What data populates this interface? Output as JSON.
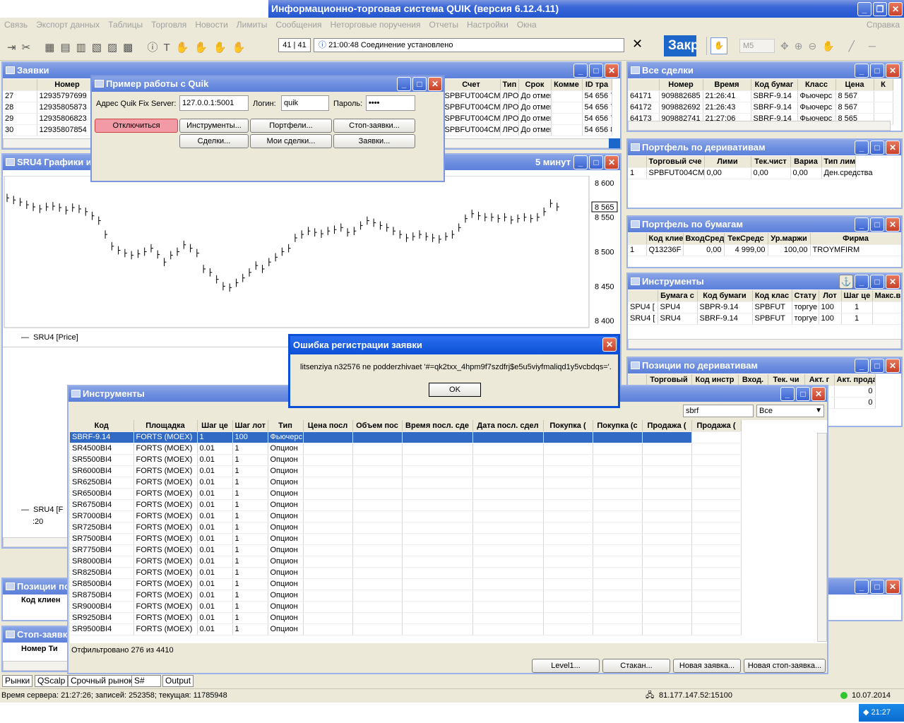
{
  "app": {
    "title": "Информационно-торговая система QUIK (версия 6.12.4.11)"
  },
  "menu": [
    "Связь",
    "Экспорт данных",
    "Таблицы",
    "Торговля",
    "Новости",
    "Лимиты",
    "Сообщения",
    "Неторговые поручения",
    "Отчеты",
    "Настройки",
    "Окна"
  ],
  "menu_help": "Справка",
  "toolbar": {
    "counter": "41 | 41",
    "status": "21:00:48  Соединение установлено",
    "close_btn": "Закр",
    "interval": "M5"
  },
  "zayavki": {
    "title": "Заявки",
    "cols": [
      "Номер",
      "Счет",
      "Тип",
      "Срок",
      "Комме",
      "ID тра"
    ],
    "rows": [
      [
        "27",
        "12935797699",
        "SPBFUT004CM",
        "ЛРО",
        "До отмен",
        "",
        "54 656 7"
      ],
      [
        "28",
        "12935805873",
        "SPBFUT004CM",
        "ЛРО",
        "До отмен",
        "",
        "54 656 7"
      ],
      [
        "29",
        "12935806823",
        "SPBFUT004CM",
        "ЛРО",
        "До отмен",
        "",
        "54 656 7"
      ],
      [
        "30",
        "12935807854",
        "SPBFUT004CM",
        "ЛРО",
        "До отмен",
        "",
        "54 656 8"
      ]
    ]
  },
  "primer": {
    "title": "Пример работы с Quik",
    "addr_label": "Адрес Quik Fix Server:",
    "addr_value": "127.0.0.1:5001",
    "login_label": "Логин:",
    "login_value": "quik",
    "pass_label": "Пароль:",
    "pass_value": "••••",
    "btn_disconnect": "Отключиться",
    "btn_instr": "Инструменты...",
    "btn_portf": "Портфели...",
    "btn_stop": "Стоп-заявки...",
    "btn_deals": "Сделки...",
    "btn_mydeals": "Мои сделки...",
    "btn_orders": "Заявки..."
  },
  "chart": {
    "title": "SRU4 Графики и",
    "interval": "5 минут",
    "legend": "SRU4 [Price]",
    "legend2": "SRU4 [F",
    "time_tick": ":20",
    "last": "8 565",
    "yticks": [
      "8 600",
      "8 550",
      "8 500",
      "8 450",
      "8 400"
    ]
  },
  "chart_data": {
    "type": "bar",
    "title": "SRU4 Графики и",
    "ylim": [
      8390,
      8610
    ],
    "series": [
      {
        "name": "SRU4 [Price]",
        "values": [
          8578,
          8575,
          8572,
          8568,
          8565,
          8562,
          8565,
          8566,
          8564,
          8560,
          8564,
          8562,
          8558,
          8552,
          8545,
          8525,
          8508,
          8502,
          8498,
          8495,
          8497,
          8500,
          8505,
          8496,
          8485,
          8495,
          8500,
          8510,
          8505,
          8498,
          8475,
          8470,
          8460,
          8450,
          8448,
          8455,
          8462,
          8470,
          8480,
          8475,
          8485,
          8492,
          8500,
          8505,
          8520,
          8525,
          8530,
          8528,
          8526,
          8530,
          8532,
          8535,
          8528,
          8530,
          8538,
          8545,
          8542,
          8538,
          8535,
          8530,
          8525,
          8520,
          8522,
          8525,
          8522,
          8520,
          8518,
          8522,
          8525,
          8535,
          8548,
          8555,
          8552,
          8550,
          8550,
          8548,
          8550,
          8546,
          8548,
          8550,
          8548,
          8550,
          8558,
          8570,
          8565
        ]
      }
    ]
  },
  "vse_sdelki": {
    "title": "Все сделки",
    "cols": [
      "Номер",
      "Время",
      "Код бумаг",
      "Класс",
      "Цена",
      "К"
    ],
    "rows": [
      [
        "64171",
        "909882685",
        "21:26:41",
        "SBRF-9.14",
        "Фьючерс",
        "8 567"
      ],
      [
        "64172",
        "909882692",
        "21:26:43",
        "SBRF-9.14",
        "Фьючерс",
        "8 567"
      ],
      [
        "64173",
        "909882741",
        "21:27:06",
        "SBRF-9.14",
        "Фьючерс",
        "8 565"
      ]
    ]
  },
  "portf_deriv": {
    "title": "Портфель по деривативам",
    "cols": [
      "Торговый сче",
      "Лими",
      "Тек.чист",
      "Вариа",
      "Тип лимита"
    ],
    "rows": [
      [
        "1",
        "SPBFUT004CM",
        "0,00",
        "0,00",
        "0,00",
        "Ден.средства"
      ]
    ]
  },
  "portf_bum": {
    "title": "Портфель по бумагам",
    "cols": [
      "Код клие",
      "ВходСред",
      "ТекСредс",
      "Ур.маржи",
      "Фирма"
    ],
    "rows": [
      [
        "1",
        "Q13236F",
        "0,00",
        "4 999,00",
        "100,00",
        "TROYMFIRM"
      ]
    ]
  },
  "instr_small": {
    "title": "Инструменты",
    "cols": [
      "Бумага с",
      "Код бумаги",
      "Код клас",
      "Стату",
      "Лот",
      "Шаг це",
      "Макс.в"
    ],
    "rows": [
      [
        "SPU4 [",
        "SPU4",
        "SBPR-9.14",
        "SPBFUT",
        "торгуе",
        "100",
        "1"
      ],
      [
        "SRU4 [",
        "SRU4",
        "SBRF-9.14",
        "SPBFUT",
        "торгуе",
        "100",
        "1"
      ]
    ]
  },
  "pozicii_deriv": {
    "title": "Позиции по деривативам",
    "cols": [
      "Торговый",
      "Код инстр",
      "Вход.",
      "Тек. чи",
      "Акт. г",
      "Акт. прода"
    ],
    "vals": [
      "0",
      "0"
    ]
  },
  "pozicii": {
    "title": "Позиции по",
    "col": "Код клиен"
  },
  "stop": {
    "title": "Стоп-заявк",
    "cols": [
      "Номер",
      "Ти"
    ]
  },
  "instr_big": {
    "title": "Инструменты",
    "filter": "sbrf",
    "filter_sel": "Все",
    "cols": [
      "Код",
      "Площадка",
      "Шаг це",
      "Шаг лот",
      "Тип",
      "Цена посл",
      "Объем пос",
      "Время посл. сде",
      "Дата посл. сдел",
      "Покупка (",
      "Покупка (с",
      "Продажа (",
      "Продажа ("
    ],
    "rows": [
      [
        "SBRF-9.14",
        "FORTS (MOEX)",
        "1",
        "100",
        "Фьючерс"
      ],
      [
        "SR4500BI4",
        "FORTS (MOEX)",
        "0.01",
        "1",
        "Опцион"
      ],
      [
        "SR5500BI4",
        "FORTS (MOEX)",
        "0.01",
        "1",
        "Опцион"
      ],
      [
        "SR6000BI4",
        "FORTS (MOEX)",
        "0.01",
        "1",
        "Опцион"
      ],
      [
        "SR6250BI4",
        "FORTS (MOEX)",
        "0.01",
        "1",
        "Опцион"
      ],
      [
        "SR6500BI4",
        "FORTS (MOEX)",
        "0.01",
        "1",
        "Опцион"
      ],
      [
        "SR6750BI4",
        "FORTS (MOEX)",
        "0.01",
        "1",
        "Опцион"
      ],
      [
        "SR7000BI4",
        "FORTS (MOEX)",
        "0.01",
        "1",
        "Опцион"
      ],
      [
        "SR7250BI4",
        "FORTS (MOEX)",
        "0.01",
        "1",
        "Опцион"
      ],
      [
        "SR7500BI4",
        "FORTS (MOEX)",
        "0.01",
        "1",
        "Опцион"
      ],
      [
        "SR7750BI4",
        "FORTS (MOEX)",
        "0.01",
        "1",
        "Опцион"
      ],
      [
        "SR8000BI4",
        "FORTS (MOEX)",
        "0.01",
        "1",
        "Опцион"
      ],
      [
        "SR8250BI4",
        "FORTS (MOEX)",
        "0.01",
        "1",
        "Опцион"
      ],
      [
        "SR8500BI4",
        "FORTS (MOEX)",
        "0.01",
        "1",
        "Опцион"
      ],
      [
        "SR8750BI4",
        "FORTS (MOEX)",
        "0.01",
        "1",
        "Опцион"
      ],
      [
        "SR9000BI4",
        "FORTS (MOEX)",
        "0.01",
        "1",
        "Опцион"
      ],
      [
        "SR9250BI4",
        "FORTS (MOEX)",
        "0.01",
        "1",
        "Опцион"
      ],
      [
        "SR9500BI4",
        "FORTS (MOEX)",
        "0.01",
        "1",
        "Опцион"
      ]
    ],
    "footer": "Отфильтровано 276 из 4410",
    "btn_level1": "Level1...",
    "btn_stakan": "Стакан...",
    "btn_new": "Новая заявка...",
    "btn_newstop": "Новая стоп-заявка..."
  },
  "error": {
    "title": "Ошибка регистрации заявки",
    "msg": "litsenziya n32576 ne podderzhivaet '#=qk2txx_4hpm9f7szdfrj$e5u5viyfmaliqd1y5vcbdqs='.",
    "ok": "OK"
  },
  "tabs": [
    "Рынки",
    "QScalp",
    "Срочный рынок",
    "S#",
    "Output"
  ],
  "status": {
    "server": "Время сервера: 21:27:26; записей: 252358; текущая: 11785948",
    "ip": "81.177.147.52:15100",
    "date": "10.07.2014"
  },
  "taskbar": {
    "time": "21:27"
  }
}
